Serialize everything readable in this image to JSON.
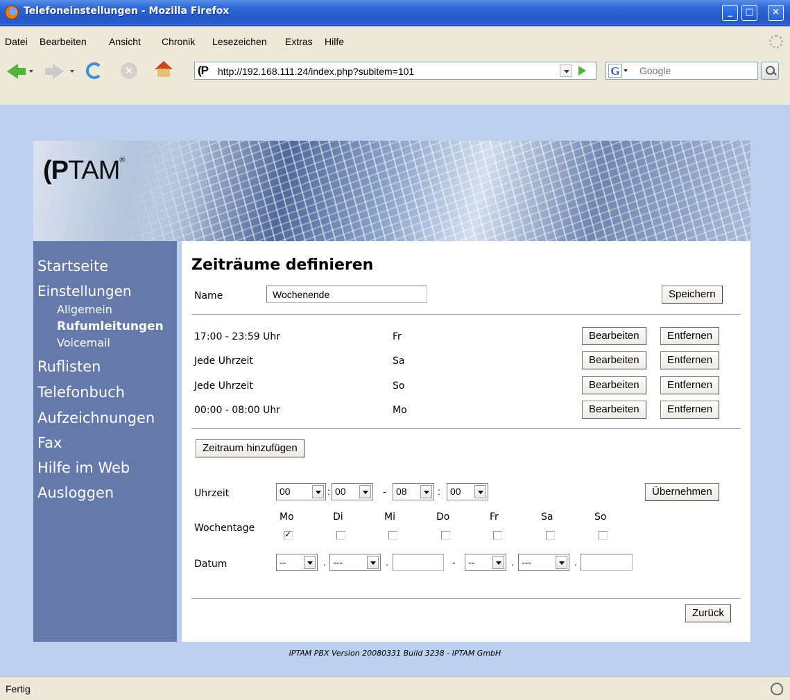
{
  "window": {
    "title": "Telefoneinstellungen - Mozilla Firefox",
    "controls": {
      "minimize": "_",
      "maximize": "□",
      "close": "×"
    }
  },
  "menubar": {
    "items": [
      "Datei",
      "Bearbeiten",
      "Ansicht",
      "Chronik",
      "Lesezeichen",
      "Extras",
      "Hilfe"
    ]
  },
  "navbar": {
    "url": "http://192.168.111.24/index.php?subitem=101",
    "site_icon": "(P",
    "search_engine_icon": "G",
    "search_placeholder": "Google"
  },
  "banner": {
    "logo_bold": "(P",
    "logo_rest": "TAM",
    "logo_mark": "®"
  },
  "sidebar": {
    "items": [
      {
        "label": "Startseite"
      },
      {
        "label": "Einstellungen"
      },
      {
        "label": "Allgemein"
      },
      {
        "label": "Rufumleitungen"
      },
      {
        "label": "Voicemail"
      },
      {
        "label": "Ruflisten"
      },
      {
        "label": "Telefonbuch"
      },
      {
        "label": "Aufzeichnungen"
      },
      {
        "label": "Fax"
      },
      {
        "label": "Hilfe im Web"
      },
      {
        "label": "Ausloggen"
      }
    ]
  },
  "content": {
    "title": "Zeiträume definieren",
    "name_label": "Name",
    "name_value": "Wochenende",
    "save_button": "Speichern",
    "periods": [
      {
        "time": "17:00 - 23:59 Uhr",
        "day": "Fr"
      },
      {
        "time": "Jede Uhrzeit",
        "day": "Sa"
      },
      {
        "time": "Jede Uhrzeit",
        "day": "So"
      },
      {
        "time": "00:00 - 08:00 Uhr",
        "day": "Mo"
      }
    ],
    "edit_button": "Bearbeiten",
    "remove_button": "Entfernen",
    "add_button": "Zeitraum hinzufügen",
    "time_label": "Uhrzeit",
    "time_from_h": "00",
    "time_from_m": "00",
    "time_to_h": "08",
    "time_to_m": "00",
    "apply_button": "Übernehmen",
    "weekdays_label": "Wochentage",
    "weekdays": [
      {
        "label": "Mo",
        "checked": true
      },
      {
        "label": "Di",
        "checked": false
      },
      {
        "label": "Mi",
        "checked": false
      },
      {
        "label": "Do",
        "checked": false
      },
      {
        "label": "Fr",
        "checked": false
      },
      {
        "label": "Sa",
        "checked": false
      },
      {
        "label": "So",
        "checked": false
      }
    ],
    "date_label": "Datum",
    "date_from_day": "--",
    "date_from_month": "---",
    "date_from_year": "",
    "date_to_day": "--",
    "date_to_month": "---",
    "date_to_year": "",
    "colon": ":",
    "dash": "-",
    "dot": ".",
    "back_button": "Zurück"
  },
  "footer": "IPTAM PBX Version 20080331 Build 3238 - IPTAM GmbH",
  "statusbar": {
    "status": "Fertig"
  }
}
